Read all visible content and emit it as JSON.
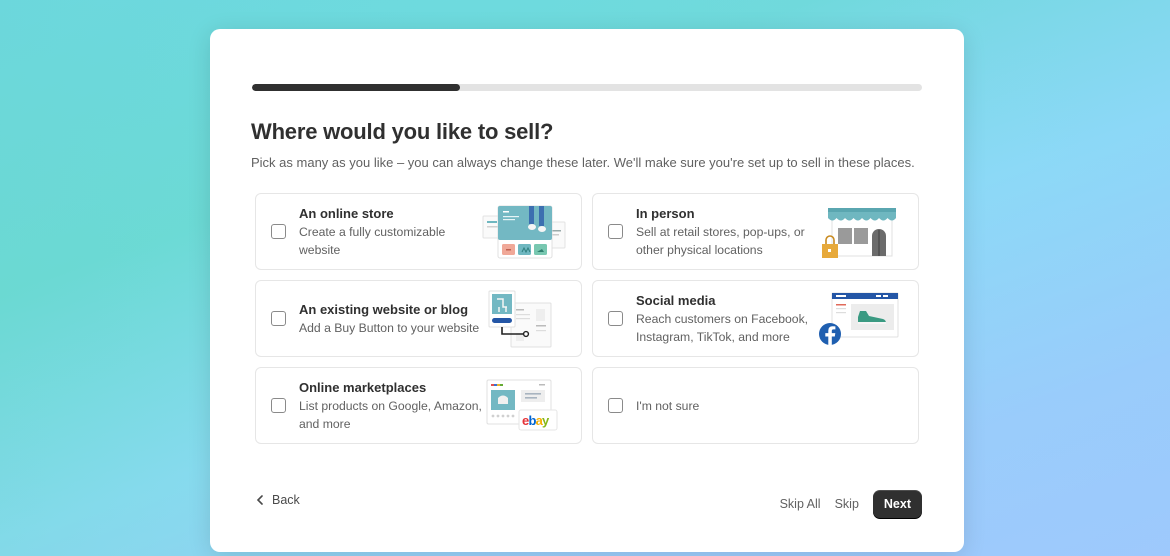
{
  "progress": {
    "fraction": 0.31
  },
  "header": {
    "title": "Where would you like to sell?",
    "subtitle": "Pick as many as you like – you can always change these later. We'll make sure you're set up to sell in these places."
  },
  "options": [
    {
      "title": "An online store",
      "description": "Create a fully customizable website",
      "illustration": "online-store-illustration",
      "checked": false
    },
    {
      "title": "In person",
      "description": "Sell at retail stores, pop-ups, or other physical locations",
      "illustration": "storefront-illustration",
      "checked": false
    },
    {
      "title": "An existing website or blog",
      "description": "Add a Buy Button to your website",
      "illustration": "buy-button-illustration",
      "checked": false
    },
    {
      "title": "Social media",
      "description": "Reach customers on Facebook, Instagram, TikTok, and more",
      "illustration": "social-media-illustration",
      "checked": false
    },
    {
      "title": "Online marketplaces",
      "description": "List products on Google, Amazon, and more",
      "illustration": "marketplace-illustration",
      "checked": false
    },
    {
      "title": "",
      "description": "I'm not sure",
      "illustration": "",
      "checked": false
    }
  ],
  "illustration_text": {
    "ebay": "ebay"
  },
  "footer": {
    "back_label": "Back",
    "skip_all_label": "Skip All",
    "skip_label": "Skip",
    "next_label": "Next"
  },
  "colors": {
    "primary_button": "#303030",
    "progress_fill": "#303030",
    "progress_track": "#e3e3e3",
    "teal": "#6fb7c0",
    "facebook_blue": "#1f5fb0"
  }
}
